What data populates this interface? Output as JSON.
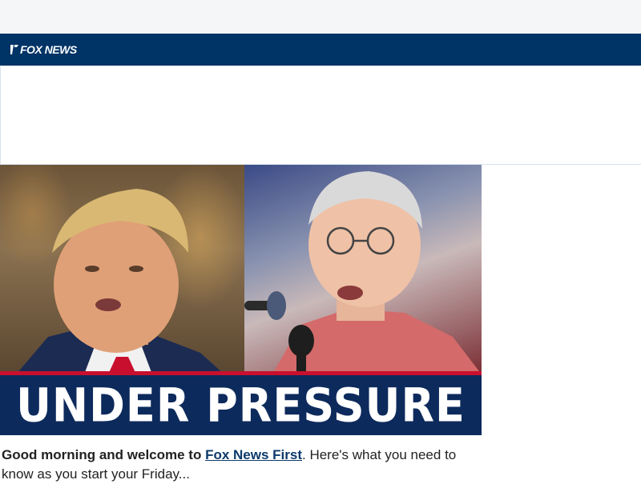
{
  "brand": {
    "logo_text": "FOX NEWS",
    "colors": {
      "header": "#003366",
      "banner": "#0d2a5c",
      "accent_red": "#c8102e"
    }
  },
  "hero": {
    "banner_text": "UNDER PRESSURE",
    "image_alt": "Two men speaking"
  },
  "intro": {
    "lead": "Good morning and welcome to",
    "link_text": "Fox News First",
    "rest": ". Here's what you need to know as you start your Friday..."
  }
}
